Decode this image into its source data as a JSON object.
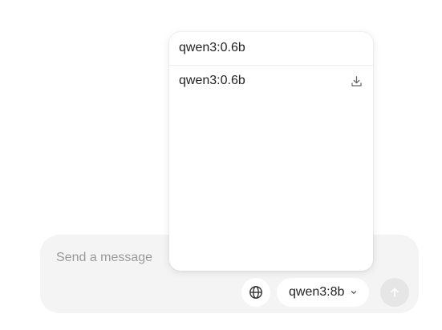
{
  "composer": {
    "placeholder": "Send a message",
    "model_selector_label": "qwen3:8b",
    "icons": {
      "web": "globe-icon",
      "chevron": "chevron-down-icon",
      "send": "arrow-up-icon"
    }
  },
  "model_dropdown": {
    "search_value": "qwen3:0.6b",
    "items": [
      {
        "label": "qwen3:0.6b",
        "icon": "download-icon"
      }
    ]
  }
}
